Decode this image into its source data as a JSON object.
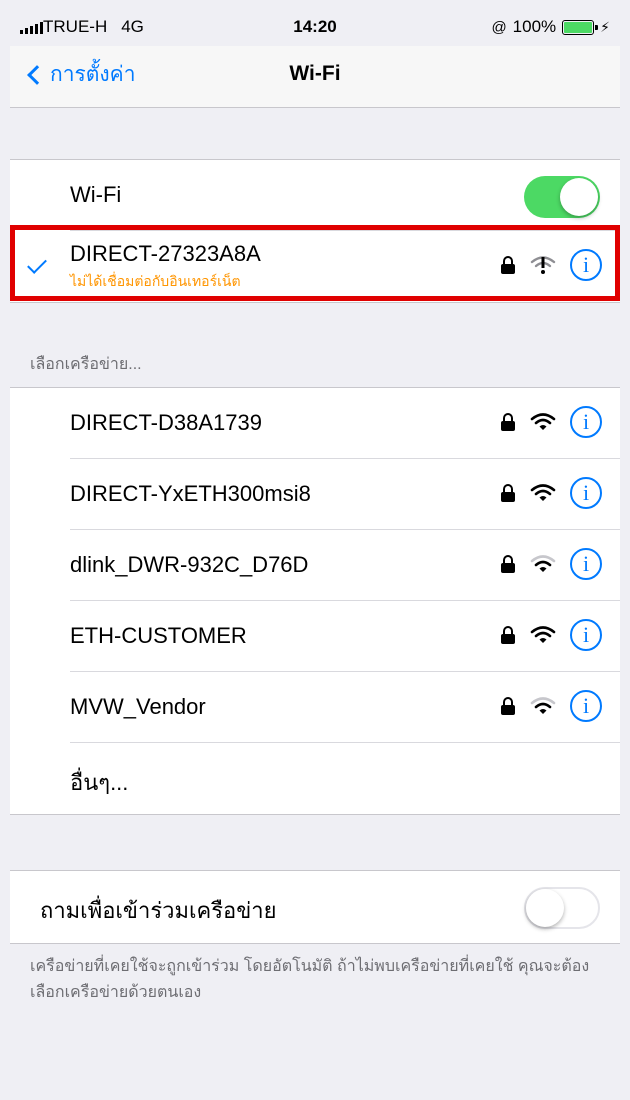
{
  "status_bar": {
    "carrier": "TRUE-H",
    "network_type": "4G",
    "time": "14:20",
    "battery_percent": "100%",
    "battery_level": 1.0
  },
  "nav": {
    "back_label": "การตั้งค่า",
    "title": "Wi-Fi"
  },
  "wifi_toggle": {
    "label": "Wi-Fi",
    "on": true
  },
  "connected_network": {
    "name": "DIRECT-27323A8A",
    "status": "ไม่ได้เชื่อมต่อกับอินเทอร์เน็ต",
    "secured": true,
    "signal_icon": "wifi-no-internet-icon"
  },
  "networks_header": "เลือกเครือข่าย...",
  "networks": [
    {
      "name": "DIRECT-D38A1739",
      "secured": true,
      "signal_bars": 3
    },
    {
      "name": "DIRECT-YxETH300msi8",
      "secured": true,
      "signal_bars": 3
    },
    {
      "name": "dlink_DWR-932C_D76D",
      "secured": true,
      "signal_bars": 2
    },
    {
      "name": "ETH-CUSTOMER",
      "secured": true,
      "signal_bars": 3
    },
    {
      "name": "MVW_Vendor",
      "secured": true,
      "signal_bars": 2
    }
  ],
  "other_label": "อื่นๆ...",
  "ask_to_join": {
    "label": "ถามเพื่อเข้าร่วมเครือข่าย",
    "on": false
  },
  "footer_note": "เครือข่ายที่เคยใช้จะถูกเข้าร่วม โดยอัตโนมัติ ถ้าไม่พบเครือข่ายที่เคยใช้ คุณจะต้องเลือกเครือข่ายด้วยตนเอง",
  "colors": {
    "accent": "#007aff",
    "toggle_on": "#4cd964",
    "warning_text": "#ff9500",
    "highlight_border": "#e00000"
  }
}
